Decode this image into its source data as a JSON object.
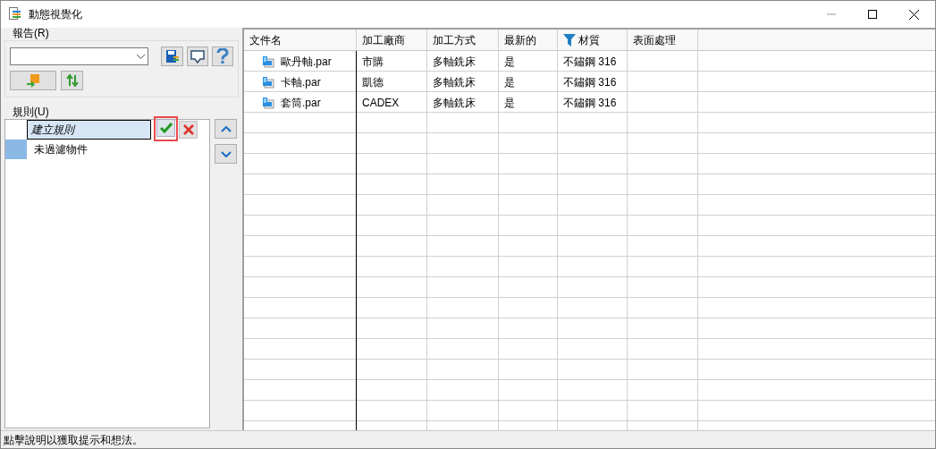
{
  "window": {
    "title": "動態視覺化"
  },
  "report": {
    "label": "報告(R)"
  },
  "rules": {
    "label": "規則(U)",
    "items": [
      {
        "kind": "editing",
        "text": "建立規則"
      },
      {
        "kind": "rule",
        "text": "未過濾物件",
        "color": "#8cb8e6"
      }
    ]
  },
  "table": {
    "columns": [
      {
        "label": "文件名",
        "filtered": false
      },
      {
        "label": "加工廠商",
        "filtered": false
      },
      {
        "label": "加工方式",
        "filtered": false
      },
      {
        "label": "最新的",
        "filtered": false
      },
      {
        "label": "材質",
        "filtered": true
      },
      {
        "label": "表面處理",
        "filtered": false
      }
    ],
    "rows": [
      [
        "歐丹軸.par",
        "市購",
        "多軸銑床",
        "是",
        "不鏽鋼 316"
      ],
      [
        "卡軸.par",
        "凱德",
        "多軸銑床",
        "是",
        "不鏽鋼 316"
      ],
      [
        "套筒.par",
        "CADEX",
        "多軸銑床",
        "是",
        "不鏽鋼 316"
      ]
    ]
  },
  "status_bar": "點擊說明以獲取提示和想法。"
}
